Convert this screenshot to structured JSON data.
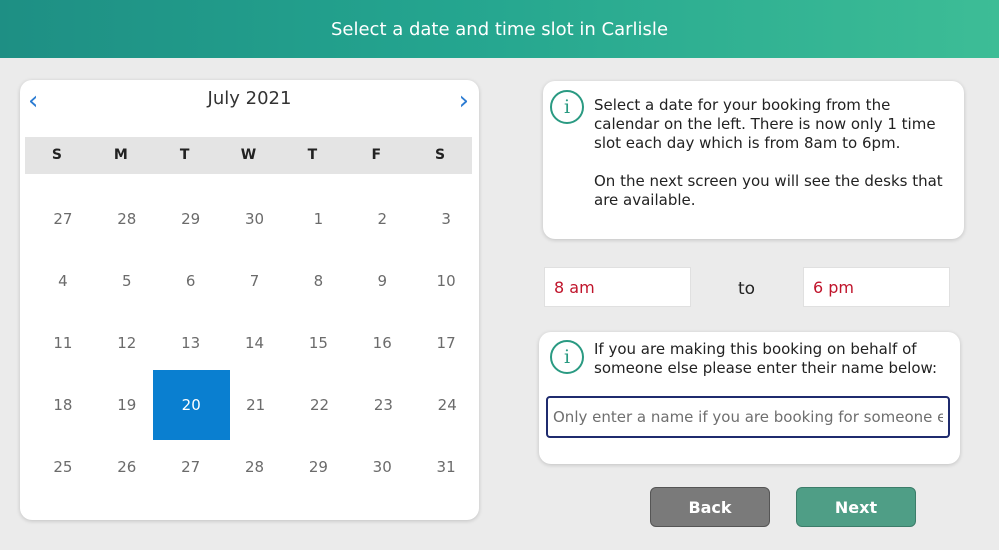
{
  "header": {
    "title": "Select a date and time slot in Carlisle"
  },
  "calendar": {
    "prev_icon": "chevron-left-icon",
    "next_icon": "chevron-right-icon",
    "prev_glyph": "‹",
    "next_glyph": "›",
    "month_label": "July 2021",
    "weekdays": [
      "S",
      "M",
      "T",
      "W",
      "T",
      "F",
      "S"
    ],
    "weeks": [
      [
        "27",
        "28",
        "29",
        "30",
        "1",
        "2",
        "3"
      ],
      [
        "4",
        "5",
        "6",
        "7",
        "8",
        "9",
        "10"
      ],
      [
        "11",
        "12",
        "13",
        "14",
        "15",
        "16",
        "17"
      ],
      [
        "18",
        "19",
        "20",
        "21",
        "22",
        "23",
        "24"
      ],
      [
        "25",
        "26",
        "27",
        "28",
        "29",
        "30",
        "31"
      ]
    ],
    "selected_day": "20",
    "selected_color": "#0a7fd0"
  },
  "info": {
    "icon": "info-icon",
    "icon_glyph": "i",
    "line1": "Select a date for your booking from the",
    "line2": "calendar on the left. There is now only 1 time",
    "line3": "slot each day which is from 8am to 6pm.",
    "line4": "On the next screen you will see the desks that",
    "line5": "are available."
  },
  "time": {
    "start": "8 am",
    "to_label": "to",
    "end": "6 pm",
    "value_color": "#c0142b"
  },
  "behalf": {
    "icon": "info-icon",
    "icon_glyph": "i",
    "line1": "If you are making this booking on behalf of",
    "line2": "someone else please enter their name below:",
    "name_placeholder": "Only enter a name if you are booking for someone else",
    "name_value": ""
  },
  "buttons": {
    "back_label": "Back",
    "next_label": "Next",
    "back_color": "#7a7a7a",
    "next_color": "#4f9e86"
  }
}
